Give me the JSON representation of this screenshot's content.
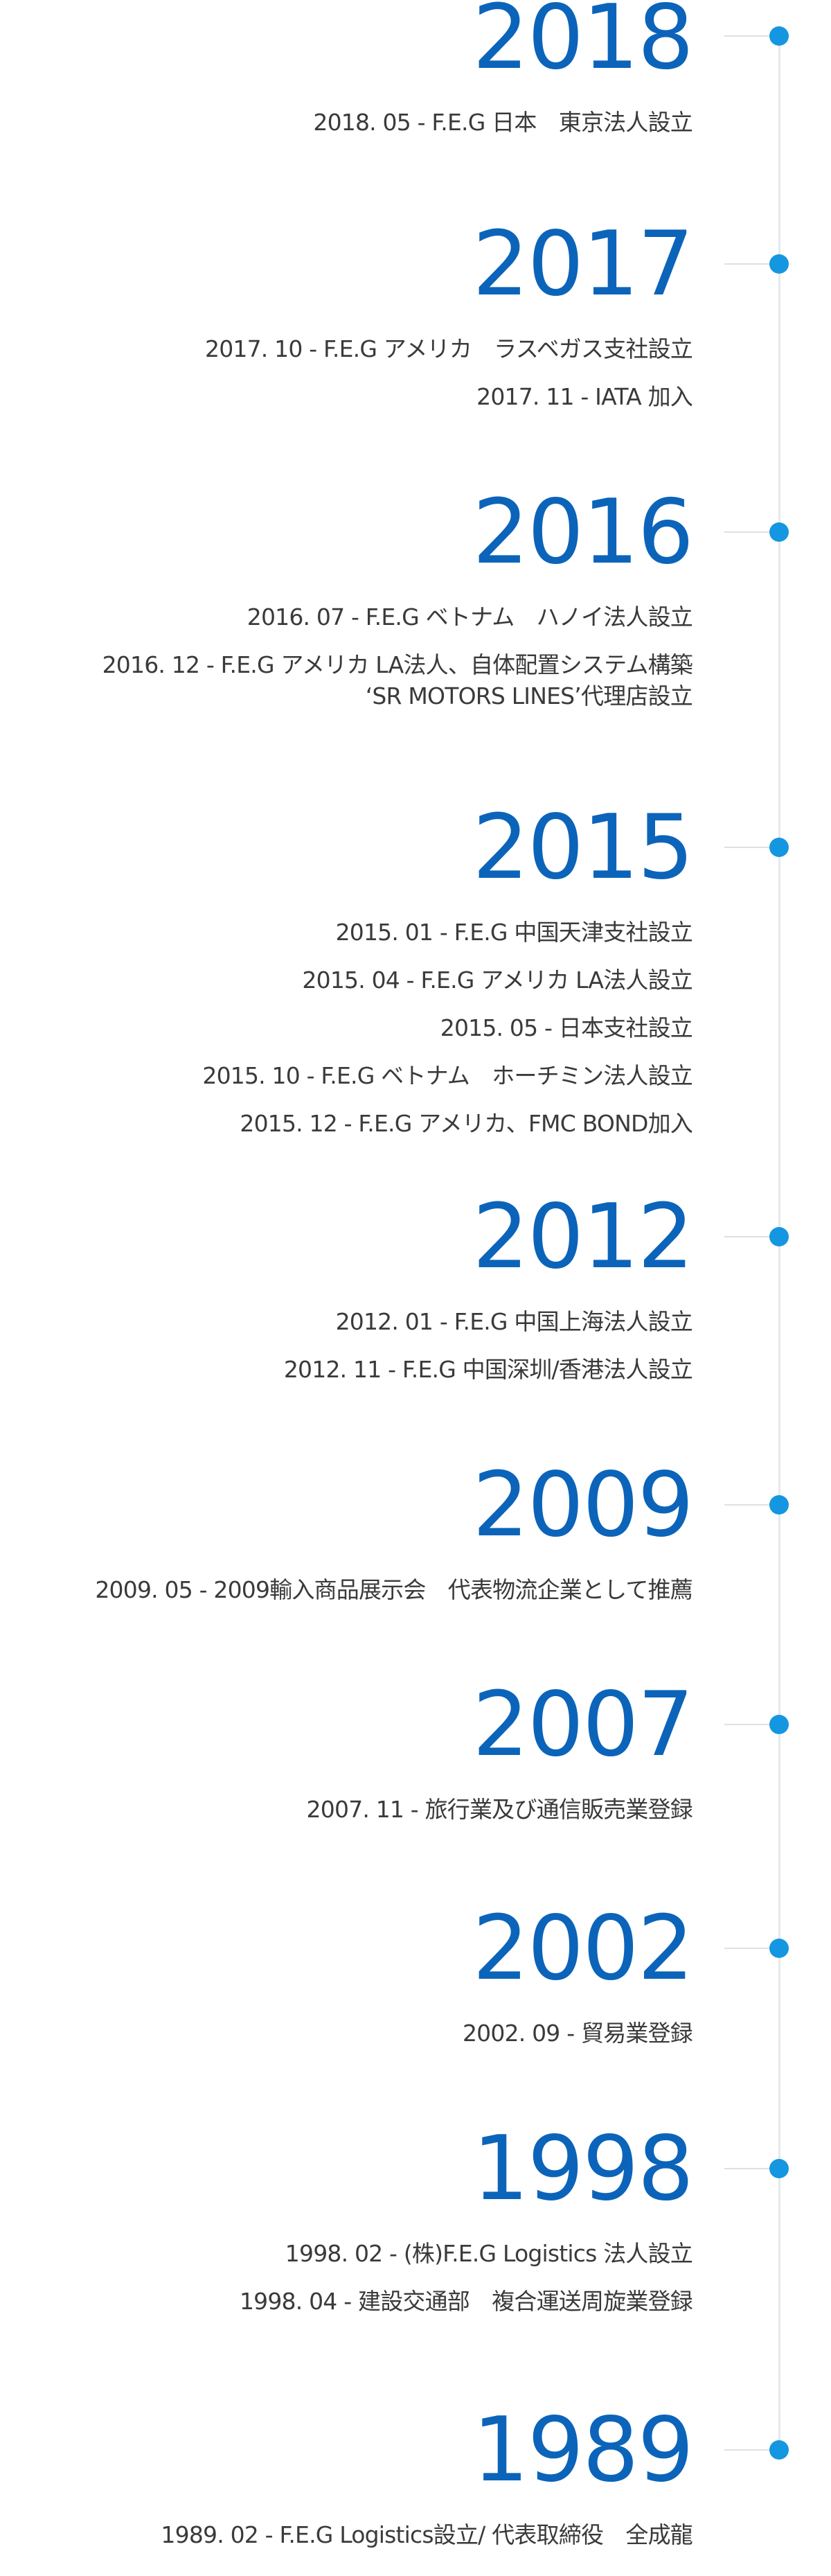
{
  "timeline": [
    {
      "year": "2018",
      "events": [
        {
          "text": "2018. 05 - F.E.G 日本　東京法人設立"
        }
      ]
    },
    {
      "year": "2017",
      "events": [
        {
          "text": "2017. 10 - F.E.G アメリカ　ラスベガス支社設立"
        },
        {
          "text": "2017. 11 - IATA 加入"
        }
      ]
    },
    {
      "year": "2016",
      "events": [
        {
          "text": "2016. 07 - F.E.G ベトナム　ハノイ法人設立"
        },
        {
          "text": "2016. 12 - F.E.G アメリカ LA法人、自体配置システム構築",
          "sub": "‘SR MOTORS LINES’代理店設立"
        }
      ]
    },
    {
      "year": "2015",
      "events": [
        {
          "text": "2015. 01 - F.E.G 中国天津支社設立"
        },
        {
          "text": "2015. 04 - F.E.G アメリカ LA法人設立"
        },
        {
          "text": "2015. 05 - 日本支社設立"
        },
        {
          "text": "2015. 10 - F.E.G ベトナム　ホーチミン法人設立"
        },
        {
          "text": "2015. 12 - F.E.G アメリカ、FMC BOND加入"
        }
      ]
    },
    {
      "year": "2012",
      "events": [
        {
          "text": "2012. 01 - F.E.G 中国上海法人設立"
        },
        {
          "text": "2012. 11 - F.E.G 中国深圳/香港法人設立"
        }
      ]
    },
    {
      "year": "2009",
      "events": [
        {
          "text": "2009. 05 - 2009輸入商品展示会　代表物流企業として推薦"
        }
      ]
    },
    {
      "year": "2007",
      "events": [
        {
          "text": "2007. 11 - 旅行業及び通信販売業登録"
        }
      ]
    },
    {
      "year": "2002",
      "events": [
        {
          "text": "2002. 09 - 貿易業登録"
        }
      ]
    },
    {
      "year": "1998",
      "events": [
        {
          "text": "1998. 02 - (株)F.E.G Logistics 法人設立"
        },
        {
          "text": "1998. 04 - 建設交通部　複合運送周旋業登録"
        }
      ]
    },
    {
      "year": "1989",
      "events": [
        {
          "text": "1989. 02 - F.E.G Logistics設立/ 代表取締役　全成龍"
        }
      ]
    }
  ]
}
